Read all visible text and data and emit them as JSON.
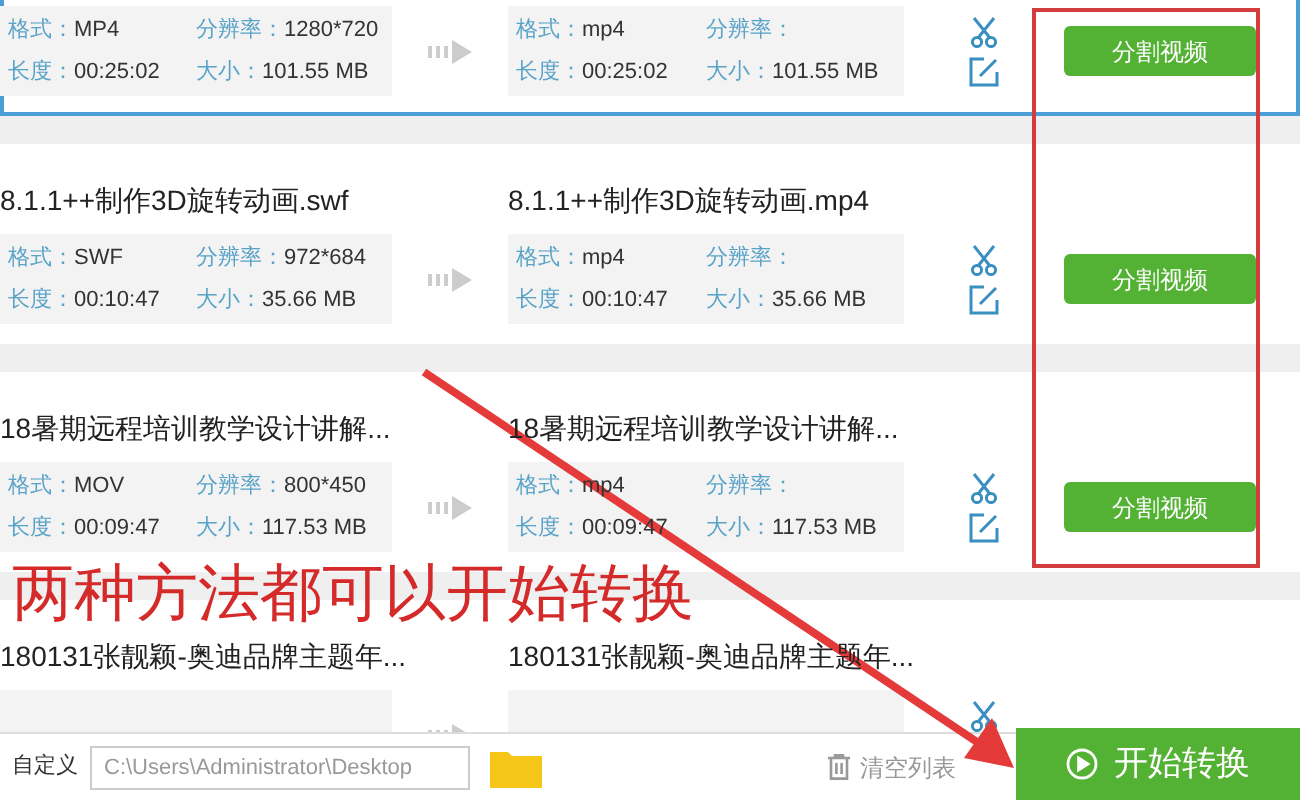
{
  "files": [
    {
      "selected": true,
      "source": [
        {
          "label": "格式：",
          "value": "MP4"
        },
        {
          "label": "分辨率：",
          "value": "1280*720"
        },
        {
          "label": "长度：",
          "value": "00:25:02"
        },
        {
          "label": "大小：",
          "value": "101.55 MB"
        }
      ],
      "output": [
        {
          "label": "格式：",
          "value": "mp4"
        },
        {
          "label": "分辨率："
        },
        {
          "label": "长度：",
          "value": "00:25:02"
        },
        {
          "label": "大小：",
          "value": "101.55 MB"
        }
      ],
      "split_button": "分割视频"
    },
    {
      "selected": false,
      "source_name": "8.1.1++制作3D旋转动画.swf",
      "output_name": "8.1.1++制作3D旋转动画.mp4",
      "source": [
        {
          "label": "格式：",
          "value": "SWF"
        },
        {
          "label": "分辨率：",
          "value": "972*684"
        },
        {
          "label": "长度：",
          "value": "00:10:47"
        },
        {
          "label": "大小：",
          "value": "35.66 MB"
        }
      ],
      "output": [
        {
          "label": "格式：",
          "value": "mp4"
        },
        {
          "label": "分辨率："
        },
        {
          "label": "长度：",
          "value": "00:10:47"
        },
        {
          "label": "大小：",
          "value": "35.66 MB"
        }
      ],
      "split_button": "分割视频"
    },
    {
      "selected": false,
      "source_name": "18暑期远程培训教学设计讲解...",
      "output_name": "18暑期远程培训教学设计讲解...",
      "source": [
        {
          "label": "格式：",
          "value": "MOV"
        },
        {
          "label": "分辨率：",
          "value": "800*450"
        },
        {
          "label": "长度：",
          "value": "00:09:47"
        },
        {
          "label": "大小：",
          "value": "117.53 MB"
        }
      ],
      "output": [
        {
          "label": "格式：",
          "value": "mp4"
        },
        {
          "label": "分辨率："
        },
        {
          "label": "长度：",
          "value": "00:09:47"
        },
        {
          "label": "大小：",
          "value": "117.53 MB"
        }
      ],
      "split_button": "分割视频"
    },
    {
      "selected": false,
      "source_name": "180131张靓颖-奥迪品牌主题年...",
      "output_name": "180131张靓颖-奥迪品牌主题年..."
    }
  ],
  "annotation": {
    "caption": "两种方法都可以开始转换"
  },
  "bottom_bar": {
    "output_label": "自定义",
    "output_path": "C:\\Users\\Administrator\\Desktop",
    "clear_button": "清空列表",
    "start_button": "开始转换"
  }
}
